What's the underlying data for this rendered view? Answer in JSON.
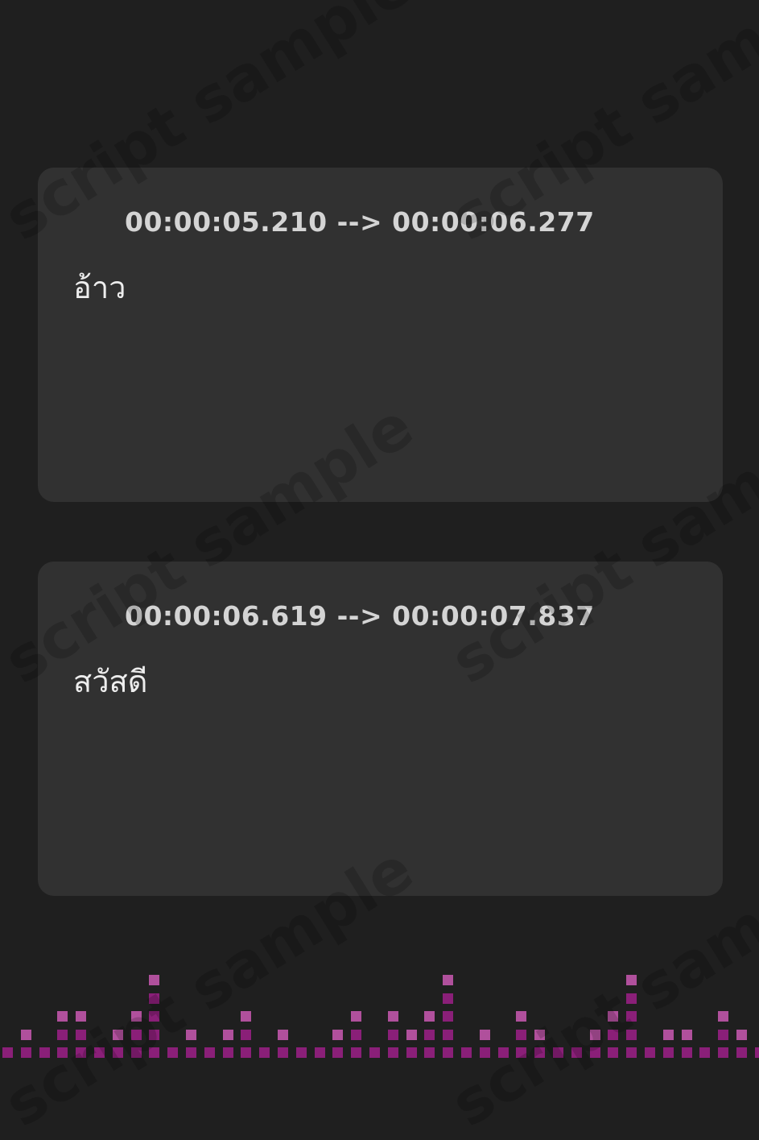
{
  "watermark_text": "script sample",
  "cards": [
    {
      "time_range": "00:00:05.210 --> 00:00:06.277",
      "text": "อ้าว"
    },
    {
      "time_range": "00:00:06.619 --> 00:00:07.837",
      "text": "สวัสดี"
    }
  ],
  "colors": {
    "background": "#1f1f1f",
    "card": "#313131",
    "accent": "#c64bd0",
    "equalizer_dark": "#8a1f78",
    "equalizer_light": "#b0509c"
  },
  "icons": {
    "card_icon": "audio-waveform-icon"
  },
  "equalizer_levels": [
    1,
    2,
    1,
    3,
    3,
    1,
    2,
    3,
    5,
    1,
    2,
    1,
    2,
    3,
    1,
    2,
    1,
    1,
    2,
    3,
    1,
    3,
    2,
    3,
    5,
    1,
    2,
    1,
    3,
    2,
    1,
    1,
    2,
    3,
    5,
    1,
    2,
    2,
    1,
    3,
    2,
    1
  ]
}
